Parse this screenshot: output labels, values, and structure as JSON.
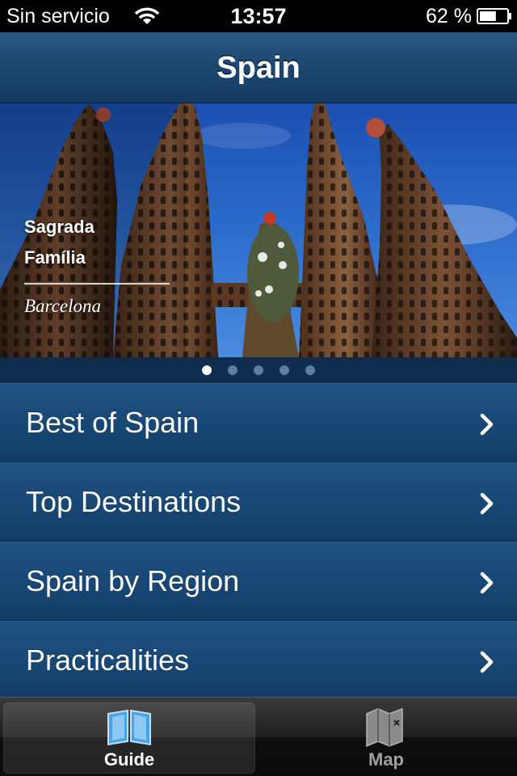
{
  "status_bar": {
    "carrier": "Sin servicio",
    "time": "13:57",
    "battery_percent": "62 %",
    "battery_level": 0.62
  },
  "nav": {
    "title": "Spain"
  },
  "hero": {
    "title_line1": "Sagrada",
    "title_line2": "Família",
    "subtitle": "Barcelona",
    "page_count": 5,
    "active_page": 1
  },
  "menu": {
    "items": [
      {
        "label": "Best of Spain",
        "icon": "chevron-right-icon"
      },
      {
        "label": "Top Destinations",
        "icon": "chevron-right-icon"
      },
      {
        "label": "Spain by Region",
        "icon": "chevron-right-icon"
      },
      {
        "label": "Practicalities",
        "icon": "chevron-right-icon"
      }
    ]
  },
  "tabs": [
    {
      "label": "Guide",
      "icon": "book-icon",
      "selected": true
    },
    {
      "label": "Map",
      "icon": "map-icon",
      "selected": false
    }
  ],
  "colors": {
    "nav_blue": "#1c4670",
    "menu_blue": "#174673",
    "sky_blue": "#2a69c9",
    "tab_selected_text": "#ffffff",
    "tab_unselected_text": "#a0a0a0"
  }
}
